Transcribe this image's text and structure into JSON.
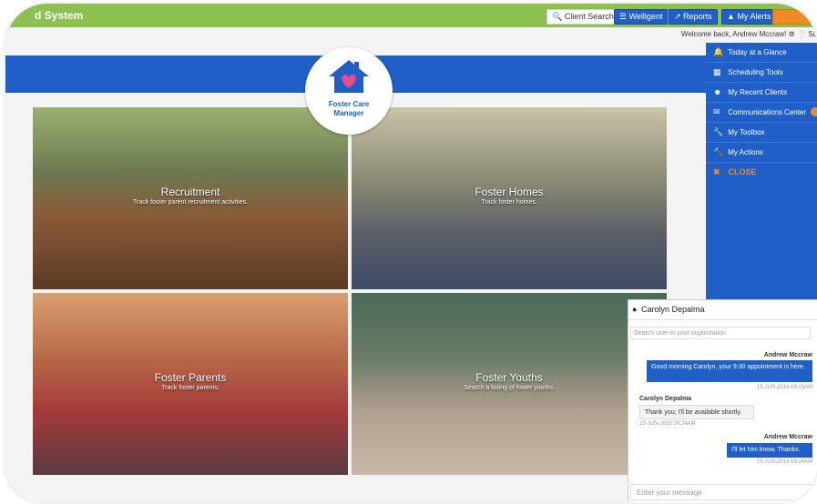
{
  "topbar": {
    "app_name": "d System",
    "client_search": "Client Search",
    "welligent": "Welligent",
    "reports": "Reports",
    "alerts": "My Alerts",
    "welcome": "Welcome back, Andrew Mccraw!",
    "support": "Su"
  },
  "logo": {
    "line1": "Foster Care",
    "line2": "Manager"
  },
  "tiles": [
    {
      "title": "Recruitment",
      "subtitle": "Track foster parent recruitment activities."
    },
    {
      "title": "Foster Homes",
      "subtitle": "Track foster homes."
    },
    {
      "title": "Foster Parents",
      "subtitle": "Track foster parents."
    },
    {
      "title": "Foster Youths",
      "subtitle": "Search a listing of foster youths."
    }
  ],
  "sidebar": {
    "items": [
      {
        "label": "Today at a Glance",
        "icon": "bell-icon"
      },
      {
        "label": "Scheduling Tools",
        "icon": "calendar-icon"
      },
      {
        "label": "My Recent Clients",
        "icon": "users-icon"
      },
      {
        "label": "Communications Center",
        "icon": "envelope-icon"
      },
      {
        "label": "My Toolbox",
        "icon": "wrench-icon"
      },
      {
        "label": "My Actions",
        "icon": "hammer-icon"
      }
    ],
    "close": "CLOSE"
  },
  "chat": {
    "contact": "Carolyn Depalma",
    "search_placeholder": "Search user in your organization",
    "messages": [
      {
        "sender": "Andrew Mccraw",
        "text": "Good morning Carolyn, your 9:30 appointment is here.",
        "time": "15-JUN-2016 09:23AM",
        "mine": true
      },
      {
        "sender": "Carolyn Depalma",
        "text": "Thank you; I'll be available shortly.",
        "time": "15-JUN-2016 09:24AM",
        "mine": false
      },
      {
        "sender": "Andrew Mccraw",
        "text": "I'll let him know. Thanks.",
        "time": "15-JUN-2016 09:24AM",
        "mine": true
      }
    ],
    "input_placeholder": "Enter your message"
  },
  "colors": {
    "green": "#8cc152",
    "blue": "#1f5fc7",
    "orange": "#f08a24"
  }
}
